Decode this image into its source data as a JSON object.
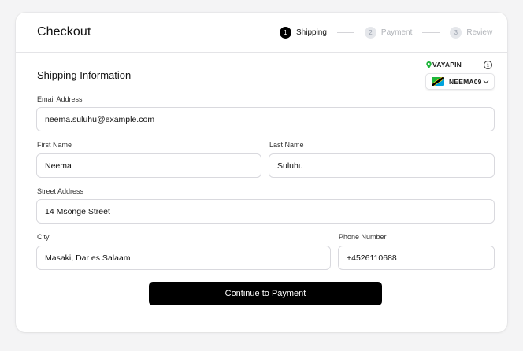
{
  "page": {
    "title": "Checkout",
    "section_title": "Shipping Information"
  },
  "steps": [
    {
      "number": "1",
      "label": "Shipping",
      "state": "active"
    },
    {
      "number": "2",
      "label": "Payment",
      "state": "inactive"
    },
    {
      "number": "3",
      "label": "Review",
      "state": "inactive"
    }
  ],
  "widget": {
    "brand": "VAYAPIN",
    "info_icon": "info-icon",
    "flag_icon": "tanzania-flag-icon",
    "selected_code": "NEEMA09"
  },
  "form": {
    "email": {
      "label": "Email Address",
      "value": "neema.suluhu@example.com"
    },
    "first_name": {
      "label": "First Name",
      "value": "Neema"
    },
    "last_name": {
      "label": "Last Name",
      "value": "Suluhu"
    },
    "street": {
      "label": "Street Address",
      "value": "14 Msonge Street"
    },
    "city": {
      "label": "City",
      "value": "Masaki, Dar es Salaam"
    },
    "phone": {
      "label": "Phone Number",
      "value": "+4526110688"
    }
  },
  "actions": {
    "continue_label": "Continue to Payment"
  },
  "colors": {
    "primary": "#000000",
    "border": "#d9d9de",
    "muted_step": "#b0b3b8",
    "flag_green": "#1eb53a",
    "flag_blue": "#00a3dd",
    "flag_yellow": "#fcd116"
  }
}
